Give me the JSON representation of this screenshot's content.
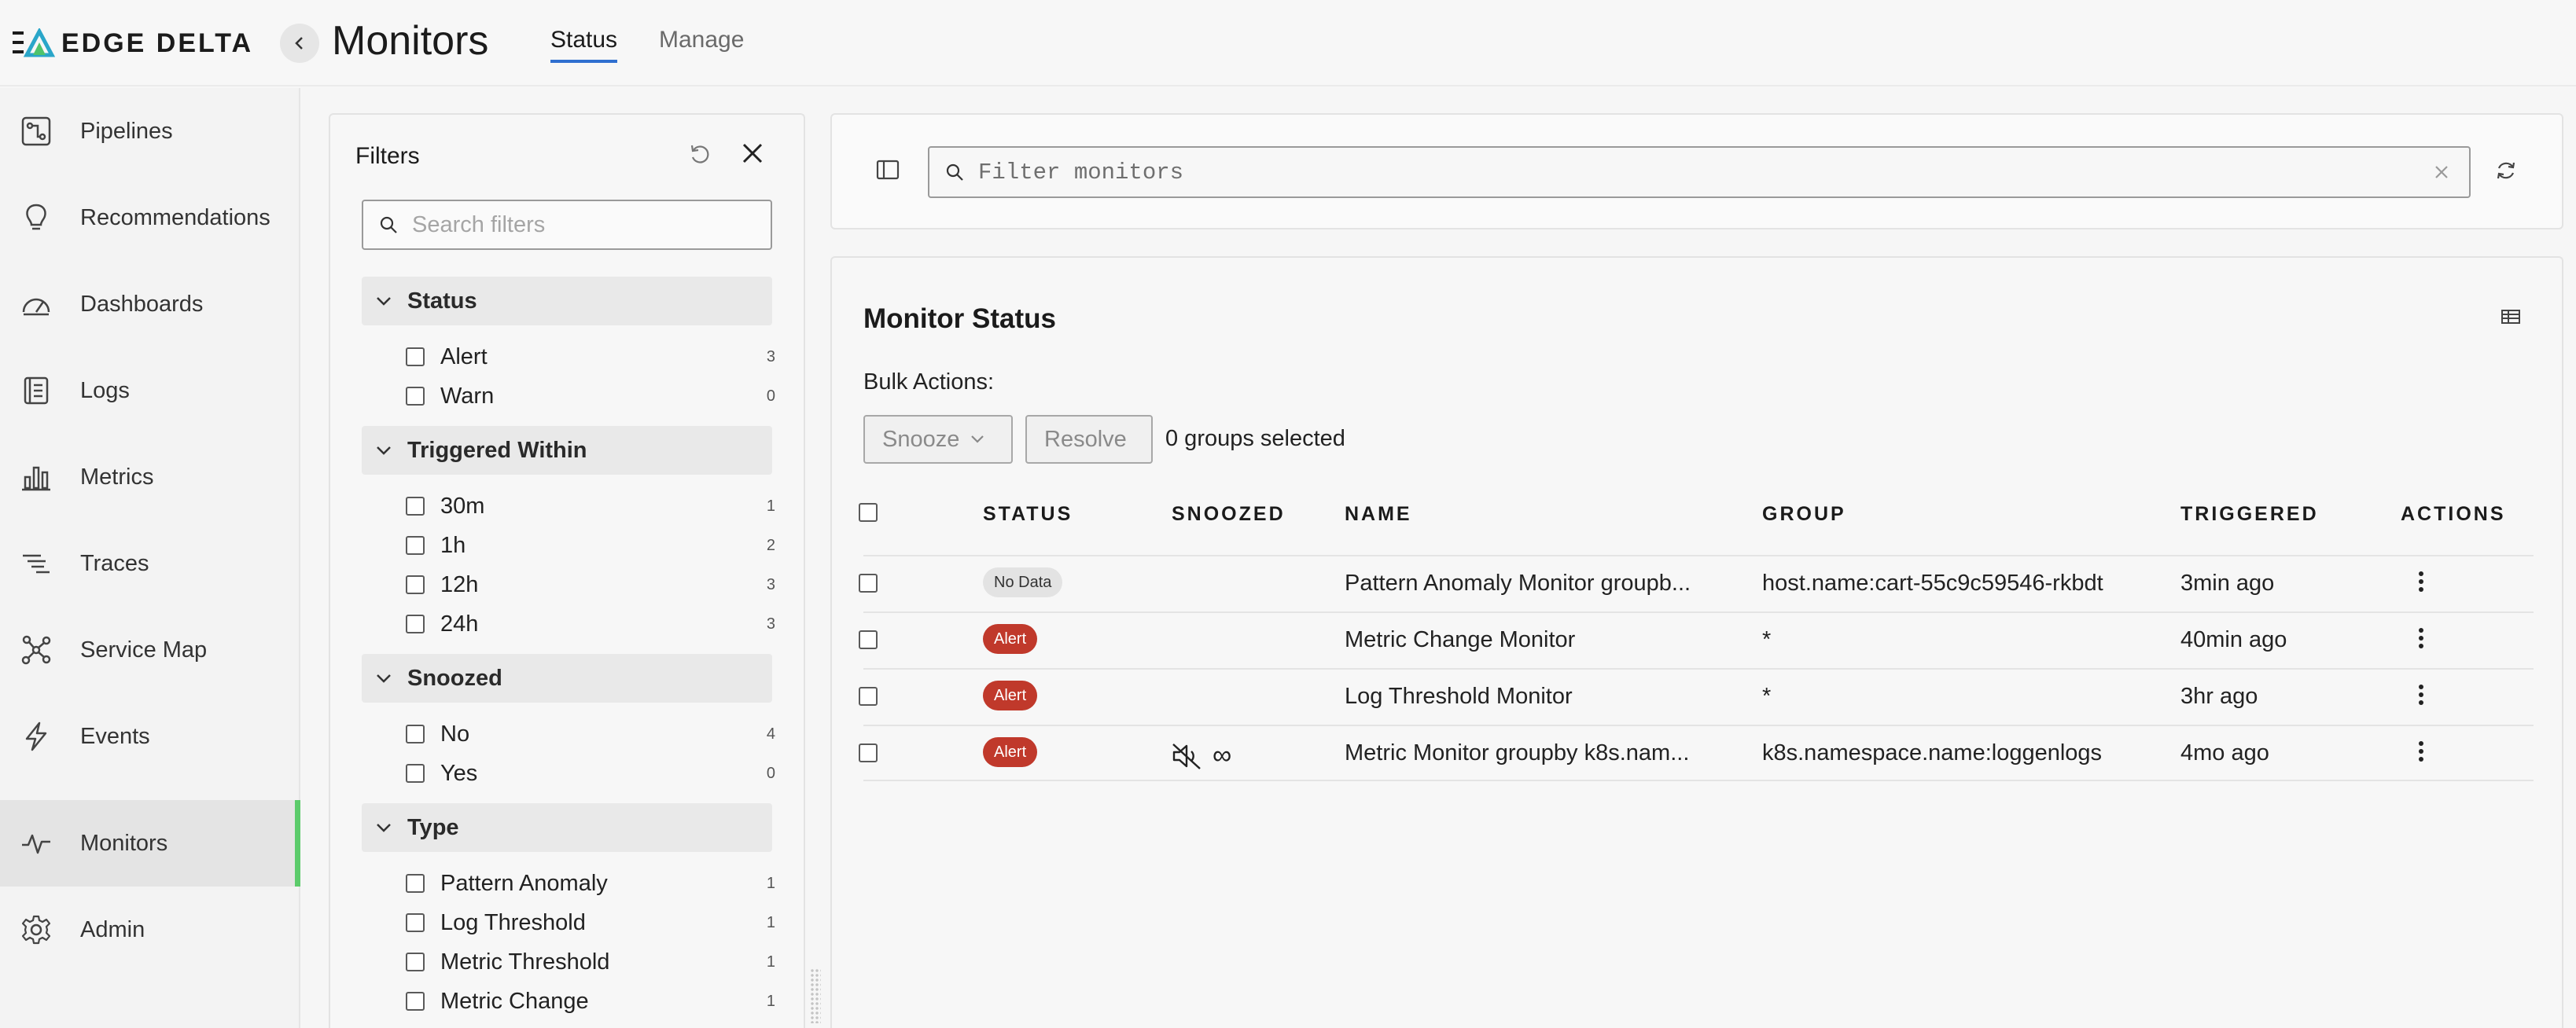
{
  "app": {
    "brand": "EDGE DELTA",
    "page_title": "Monitors",
    "accent": "#5ccb6b",
    "tab_accent": "#2f6fd0"
  },
  "tabs": [
    {
      "label": "Status",
      "active": true
    },
    {
      "label": "Manage",
      "active": false
    }
  ],
  "sidebar": {
    "items": [
      {
        "label": "Pipelines",
        "icon": "pipelines-icon"
      },
      {
        "label": "Recommendations",
        "icon": "lightbulb-icon"
      },
      {
        "label": "Dashboards",
        "icon": "gauge-icon"
      },
      {
        "label": "Logs",
        "icon": "logs-icon"
      },
      {
        "label": "Metrics",
        "icon": "bar-chart-icon"
      },
      {
        "label": "Traces",
        "icon": "traces-icon"
      },
      {
        "label": "Service Map",
        "icon": "service-map-icon"
      },
      {
        "label": "Events",
        "icon": "lightning-icon"
      },
      {
        "label": "Monitors",
        "icon": "pulse-icon",
        "active": true
      },
      {
        "label": "Admin",
        "icon": "gear-icon"
      }
    ]
  },
  "filters": {
    "title": "Filters",
    "search_placeholder": "Search filters",
    "groups": [
      {
        "title": "Status",
        "options": [
          {
            "label": "Alert",
            "count": "3"
          },
          {
            "label": "Warn",
            "count": "0"
          }
        ]
      },
      {
        "title": "Triggered Within",
        "options": [
          {
            "label": "30m",
            "count": "1"
          },
          {
            "label": "1h",
            "count": "2"
          },
          {
            "label": "12h",
            "count": "3"
          },
          {
            "label": "24h",
            "count": "3"
          }
        ]
      },
      {
        "title": "Snoozed",
        "options": [
          {
            "label": "No",
            "count": "4"
          },
          {
            "label": "Yes",
            "count": "0"
          }
        ]
      },
      {
        "title": "Type",
        "options": [
          {
            "label": "Pattern Anomaly",
            "count": "1"
          },
          {
            "label": "Log Threshold",
            "count": "1"
          },
          {
            "label": "Metric Threshold",
            "count": "1"
          },
          {
            "label": "Metric Change",
            "count": "1"
          }
        ]
      }
    ]
  },
  "toolbar": {
    "filter_placeholder": "Filter monitors"
  },
  "status": {
    "title": "Monitor Status",
    "bulk_label": "Bulk Actions:",
    "snooze_label": "Snooze",
    "resolve_label": "Resolve",
    "selected_text": "0 groups selected",
    "columns": {
      "status": "STATUS",
      "snoozed": "SNOOZED",
      "name": "NAME",
      "group": "GROUP",
      "triggered": "TRIGGERED",
      "actions": "ACTIONS"
    },
    "rows": [
      {
        "status": "No Data",
        "status_type": "nodata",
        "snoozed": false,
        "name": "Pattern Anomaly Monitor groupb...",
        "group": "host.name:cart-55c9c59546-rkbdt",
        "triggered": "3min ago"
      },
      {
        "status": "Alert",
        "status_type": "alert",
        "snoozed": false,
        "name": "Metric Change Monitor",
        "group": "*",
        "triggered": "40min ago"
      },
      {
        "status": "Alert",
        "status_type": "alert",
        "snoozed": false,
        "name": "Log Threshold Monitor",
        "group": "*",
        "triggered": "3hr ago"
      },
      {
        "status": "Alert",
        "status_type": "alert",
        "snoozed": true,
        "snooze_symbol": "∞",
        "name": "Metric Monitor groupby k8s.nam...",
        "group": "k8s.namespace.name:loggenlogs",
        "triggered": "4mo ago"
      }
    ]
  }
}
